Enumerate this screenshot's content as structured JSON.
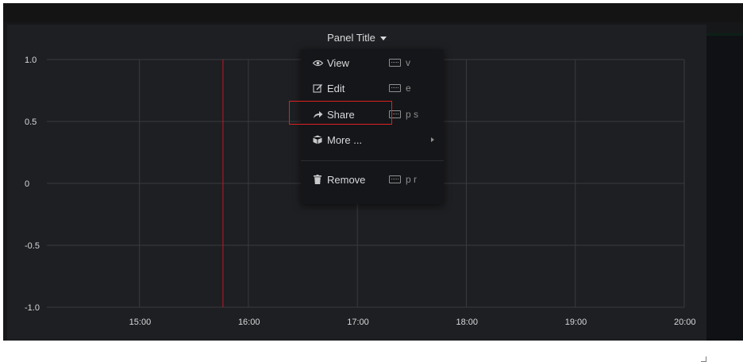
{
  "panel": {
    "title": "Panel Title"
  },
  "menu": {
    "items": [
      {
        "label": "View",
        "shortcut": "v",
        "icon": "eye-icon"
      },
      {
        "label": "Edit",
        "shortcut": "e",
        "icon": "edit-icon"
      },
      {
        "label": "Share",
        "shortcut": "p s",
        "icon": "share-icon"
      },
      {
        "label": "More ...",
        "shortcut": "",
        "icon": "cube-icon",
        "has_submenu": true
      },
      {
        "label": "Remove",
        "shortcut": "p r",
        "icon": "trash-icon"
      }
    ],
    "highlighted_item": "Edit"
  },
  "colors": {
    "background": "#161719",
    "panel": "#1e1f22",
    "menu": "#141619",
    "text": "#d8d9da",
    "grid": "#3a3b3e",
    "marker": "#c4162a",
    "highlight": "#e02020"
  },
  "chart_data": {
    "type": "line",
    "xlabel": "",
    "ylabel": "",
    "x_ticks": [
      "15:00",
      "16:00",
      "17:00",
      "18:00",
      "19:00",
      "20:00"
    ],
    "y_ticks": [
      "1.0",
      "0.5",
      "0",
      "-0.5",
      "-1.0"
    ],
    "ylim": [
      -1.0,
      1.0
    ],
    "xlim": [
      "14:09",
      "20:00"
    ],
    "series": [],
    "marker_time": "15:46",
    "grid": true,
    "legend": "none"
  }
}
